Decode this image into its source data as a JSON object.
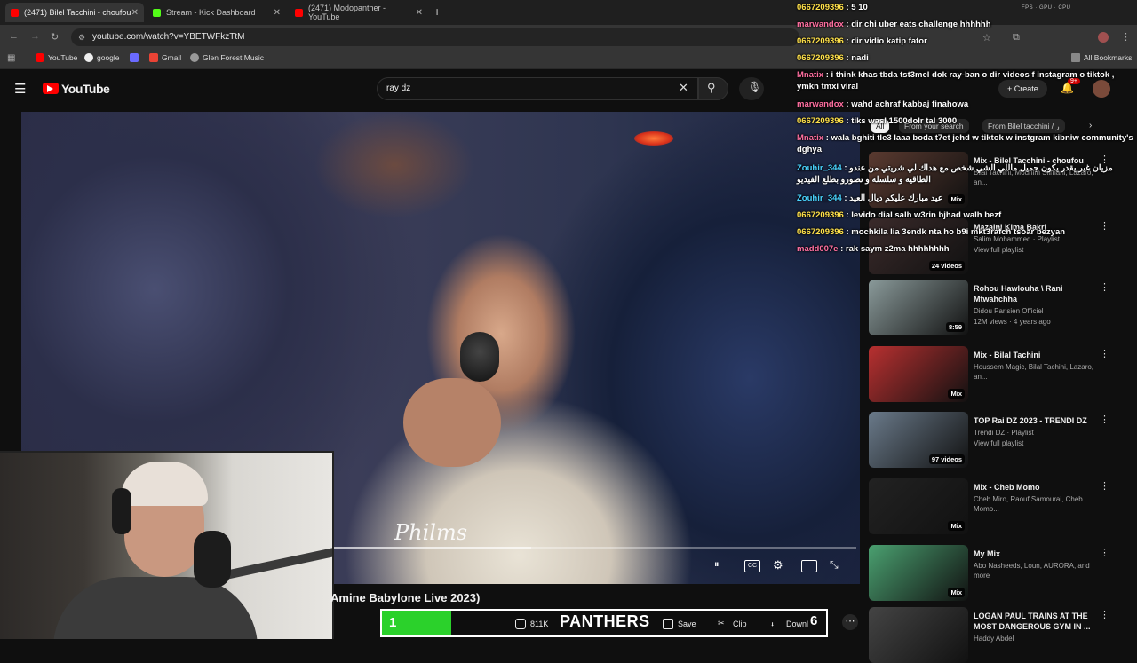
{
  "browser": {
    "tabs": [
      {
        "label": "(2471) Bilel Tacchini - choufou",
        "favicon_color": "#ff0000",
        "active": true
      },
      {
        "label": "Stream - Kick Dashboard",
        "favicon_color": "#53fc18",
        "active": false
      },
      {
        "label": "(2471) Modopanther - YouTube",
        "favicon_color": "#ff0000",
        "active": false
      }
    ],
    "url": "youtube.com/watch?v=YBETWFkzTtM",
    "bookmarks": [
      "YouTube",
      "google",
      "Gmail",
      "Glen Forest Music"
    ],
    "all_bookmarks": "All Bookmarks"
  },
  "youtube": {
    "logo": "YouTube",
    "search_value": "ray dz",
    "create_label": "Create",
    "notif_count": "9+"
  },
  "video": {
    "watermark": "Philms",
    "progress": 0.38,
    "title_partial": "Amine Babylone Live 2023)"
  },
  "actions": {
    "likes": "811K",
    "save": "Save",
    "clip": "Clip",
    "download": "Downl"
  },
  "overlay": {
    "panthers_label": "PANTHERS",
    "score_left": "1",
    "score_right": "6"
  },
  "chips": [
    "All",
    "From your search",
    "From Bilel tacchini / ر"
  ],
  "recommendations": [
    {
      "title": "Mix - Bilel Tacchini - choufou",
      "sub": "Bilal Tachini, Mounim Slimani, Lazaro, an...",
      "sub2": "",
      "badge": "Mix",
      "thumb": "#5a3a30"
    },
    {
      "title": "Mazalni Kima Bakri",
      "sub": "Salim Mohammed · Playlist",
      "sub2": "View full playlist",
      "badge": "24 videos",
      "thumb": "#3a2a2a"
    },
    {
      "title": "Rohou Hawlouha \\ Rani Mtwahchha",
      "sub": "Didou Parisien Officiel",
      "sub2": "12M views · 4 years ago",
      "badge": "8:59",
      "thumb": "#8a9a9a"
    },
    {
      "title": "Mix - Bilal Tachini",
      "sub": "Houssem Magic, Bilal Tachini, Lazaro, an...",
      "sub2": "",
      "badge": "Mix",
      "thumb": "#b83030"
    },
    {
      "title": "TOP Rai DZ 2023 - TRENDI DZ",
      "sub": "Trendi DZ · Playlist",
      "sub2": "View full playlist",
      "badge": "97 videos",
      "thumb": "#6a7a8a"
    },
    {
      "title": "Mix - Cheb Momo",
      "sub": "Cheb Miro, Raouf Samourai, Cheb Momo...",
      "sub2": "",
      "badge": "Mix",
      "thumb": "#222222"
    },
    {
      "title": "My Mix",
      "sub": "Abo Nasheeds, Loun, AURORA, and more",
      "sub2": "",
      "badge": "Mix",
      "thumb": "#4aa070"
    },
    {
      "title": "LOGAN PAUL TRAINS AT THE MOST DANGEROUS GYM IN ...",
      "sub": "Haddy Abdel",
      "sub2": "",
      "badge": "",
      "thumb": "#444444"
    }
  ],
  "chat": [
    {
      "user": "0667209396",
      "color": "#ffe14a",
      "text": " : 5 10"
    },
    {
      "user": "marwandox",
      "color": "#ff6fa0",
      "text": " : dir chi uber eats challenge hhhhhh"
    },
    {
      "user": "0667209396",
      "color": "#ffe14a",
      "text": " : dir vidio katip fator"
    },
    {
      "user": "0667209396",
      "color": "#ffe14a",
      "text": " : nadi"
    },
    {
      "user": "Mnatix",
      "color": "#ff6fa0",
      "text": " : i think khas tbda tst3mel dok ray-ban o dir videos f instagram o tiktok , ymkn tmxi viral"
    },
    {
      "user": "marwandox",
      "color": "#ff6fa0",
      "text": " : wahd achraf kabbaj finahowa"
    },
    {
      "user": "0667209396",
      "color": "#ffe14a",
      "text": " : tiks wasl 1500dolr tal 3000"
    },
    {
      "user": "Mnatix",
      "color": "#ff6fa0",
      "text": " : wala bghiti tle3 laaa boda t7et jehd w tiktok w instgram kibniw community's dghya"
    },
    {
      "user": "Zouhir_344",
      "color": "#4ad4ff",
      "text": " : مزيان غير يقدر يكون جميل ماللي الشي شخص مع هداك لي شريتي من عندو الطاقية و سلسلة و تصورو بطلع الفيديو"
    },
    {
      "user": "Zouhir_344",
      "color": "#4ad4ff",
      "text": " : عيد مبارك عليكم ديال العيد"
    },
    {
      "user": "0667209396",
      "color": "#ffe14a",
      "text": " : levido dial salh w3rin bjhad walh bezf"
    },
    {
      "user": "0667209396",
      "color": "#ffe14a",
      "text": " : mochkila lia 3endk nta ho b9i mkt3rafch tsoar bezyan"
    },
    {
      "user": "madd007e",
      "color": "#ff6fa0",
      "text": " : rak saym z2ma hhhhhhhh"
    }
  ]
}
